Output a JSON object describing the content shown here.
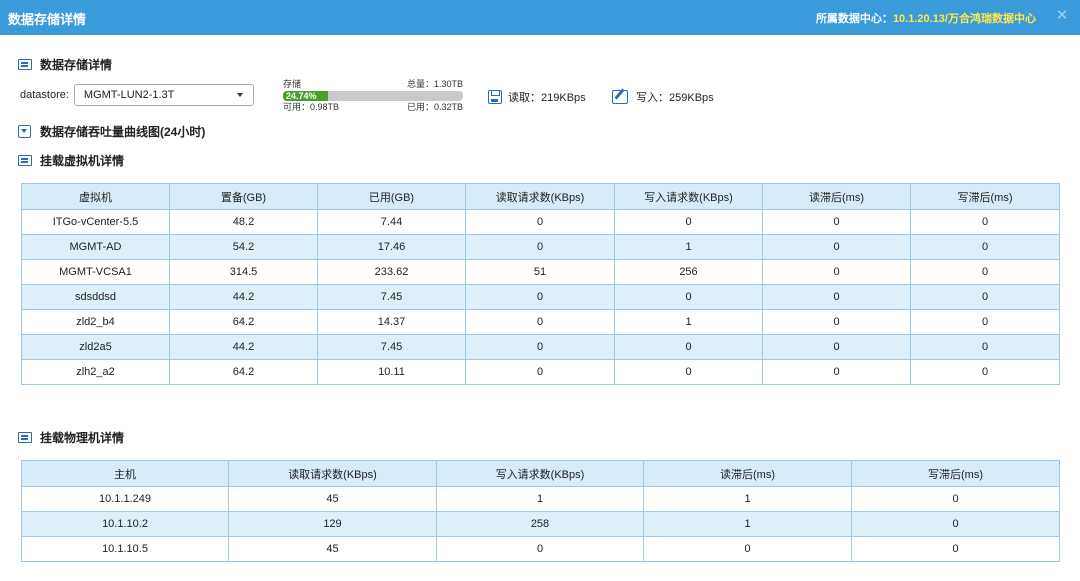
{
  "window": {
    "title": "数据存储详情",
    "dc_label": "所属数据中心：",
    "dc_value": "10.1.20.13/万合鸿瑞数据中心",
    "close_glyph": "✕"
  },
  "sections": {
    "storage_detail": "数据存储详情",
    "throughput_chart": "数据存储吞吐量曲线图(24小时)",
    "vm_detail": "挂载虚拟机详情",
    "host_detail": "挂载物理机详情"
  },
  "datastore": {
    "label": "datastore:",
    "selected": "MGMT-LUN2-1.3T"
  },
  "storage": {
    "label": "存储",
    "total": "总量：1.30TB",
    "percent_text": "24.74%",
    "used_fraction": 0.2474,
    "available": "可用：0.98TB",
    "used": "已用：0.32TB"
  },
  "io": {
    "read": "读取：219KBps",
    "write": "写入：259KBps"
  },
  "vm_table": {
    "headers": [
      "虚拟机",
      "置备(GB)",
      "已用(GB)",
      "读取请求数(KBps)",
      "写入请求数(KBps)",
      "读滞后(ms)",
      "写滞后(ms)"
    ],
    "rows": [
      [
        "ITGo-vCenter-5.5",
        "48.2",
        "7.44",
        "0",
        "0",
        "0",
        "0"
      ],
      [
        "MGMT-AD",
        "54.2",
        "17.46",
        "0",
        "1",
        "0",
        "0"
      ],
      [
        "MGMT-VCSA1",
        "314.5",
        "233.62",
        "51",
        "256",
        "0",
        "0"
      ],
      [
        "sdsddsd",
        "44.2",
        "7.45",
        "0",
        "0",
        "0",
        "0"
      ],
      [
        "zld2_b4",
        "64.2",
        "14.37",
        "0",
        "1",
        "0",
        "0"
      ],
      [
        "zld2a5",
        "44.2",
        "7.45",
        "0",
        "0",
        "0",
        "0"
      ],
      [
        "zlh2_a2",
        "64.2",
        "10.11",
        "0",
        "0",
        "0",
        "0"
      ]
    ]
  },
  "host_table": {
    "headers": [
      "主机",
      "读取请求数(KBps)",
      "写入请求数(KBps)",
      "读滞后(ms)",
      "写滞后(ms)"
    ],
    "rows": [
      [
        "10.1.1.249",
        "45",
        "1",
        "1",
        "0"
      ],
      [
        "10.1.10.2",
        "129",
        "258",
        "1",
        "0"
      ],
      [
        "10.1.10.5",
        "45",
        "0",
        "0",
        "0"
      ]
    ]
  },
  "colors": {
    "titlebar": "#3b9ad9",
    "dc_value": "#ffe84a",
    "bar_fill": "#4c9d2f",
    "table_header": "#d7ebf8",
    "row_alt": "#deeffa"
  }
}
